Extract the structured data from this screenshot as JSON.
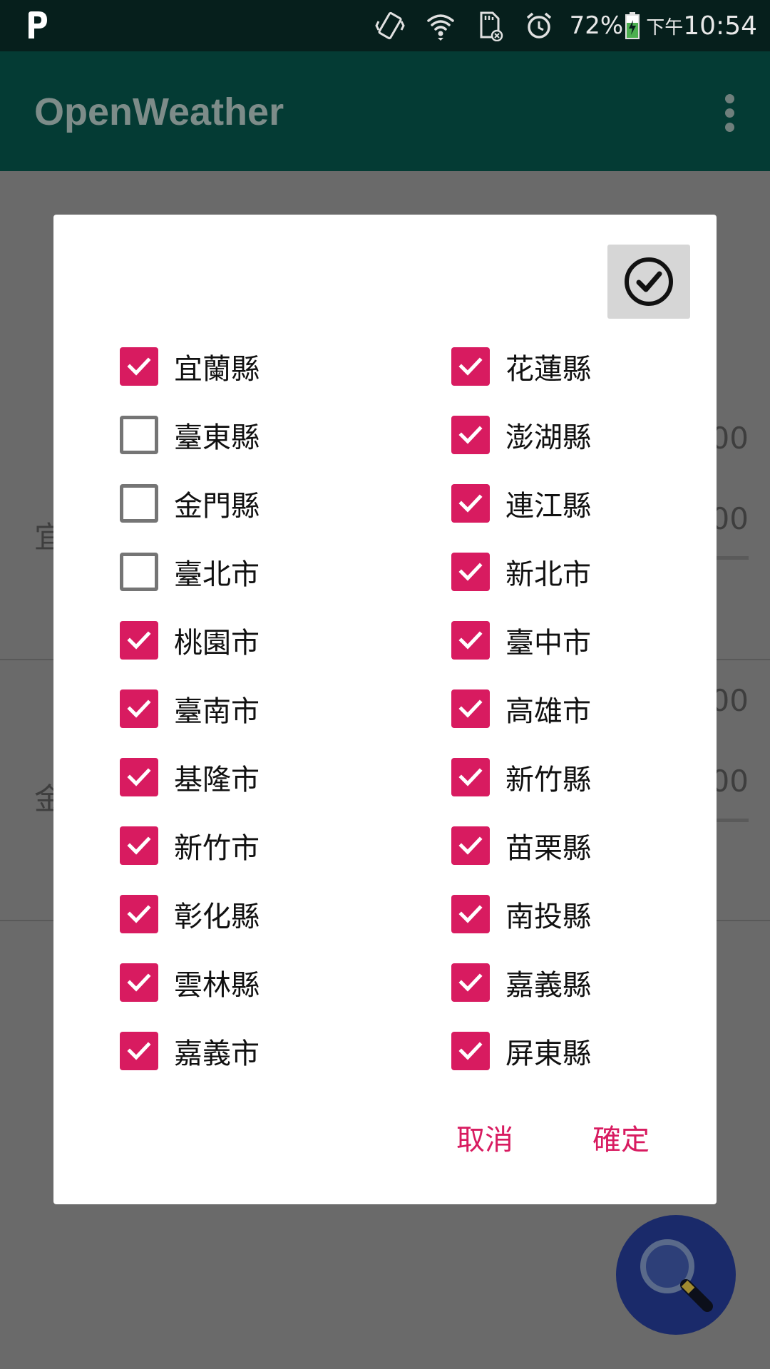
{
  "status_bar": {
    "battery": "72%",
    "ampm": "下午",
    "time": "10:54",
    "icons": [
      "p-app-icon",
      "vibrate-icon",
      "wifi-icon",
      "sd-card-icon",
      "alarm-icon",
      "battery-charging-icon"
    ]
  },
  "app_bar": {
    "title": "OpenWeather",
    "menu_icon": "overflow-menu-icon"
  },
  "background": {
    "partial_left": [
      "宜",
      "金"
    ],
    "partial_right": [
      "00",
      "00",
      "00",
      "00"
    ]
  },
  "dialog": {
    "select_all_icon": "check-circle-icon",
    "left_column": [
      {
        "label": "宜蘭縣",
        "checked": true
      },
      {
        "label": "臺東縣",
        "checked": false
      },
      {
        "label": "金門縣",
        "checked": false
      },
      {
        "label": "臺北市",
        "checked": false
      },
      {
        "label": "桃園市",
        "checked": true
      },
      {
        "label": "臺南市",
        "checked": true
      },
      {
        "label": "基隆市",
        "checked": true
      },
      {
        "label": "新竹市",
        "checked": true
      },
      {
        "label": "彰化縣",
        "checked": true
      },
      {
        "label": "雲林縣",
        "checked": true
      },
      {
        "label": "嘉義市",
        "checked": true
      }
    ],
    "right_column": [
      {
        "label": "花蓮縣",
        "checked": true
      },
      {
        "label": "澎湖縣",
        "checked": true
      },
      {
        "label": "連江縣",
        "checked": true
      },
      {
        "label": "新北市",
        "checked": true
      },
      {
        "label": "臺中市",
        "checked": true
      },
      {
        "label": "高雄市",
        "checked": true
      },
      {
        "label": "新竹縣",
        "checked": true
      },
      {
        "label": "苗栗縣",
        "checked": true
      },
      {
        "label": "南投縣",
        "checked": true
      },
      {
        "label": "嘉義縣",
        "checked": true
      },
      {
        "label": "屏東縣",
        "checked": true
      }
    ],
    "cancel_label": "取消",
    "ok_label": "確定"
  },
  "fab": {
    "icon": "search-magnifier-icon"
  },
  "colors": {
    "accent": "#d81b60",
    "status_bar": "#061f1c",
    "app_bar": "#043b34",
    "scrim": "#6a6a6a",
    "fab": "#1a2a6a"
  }
}
